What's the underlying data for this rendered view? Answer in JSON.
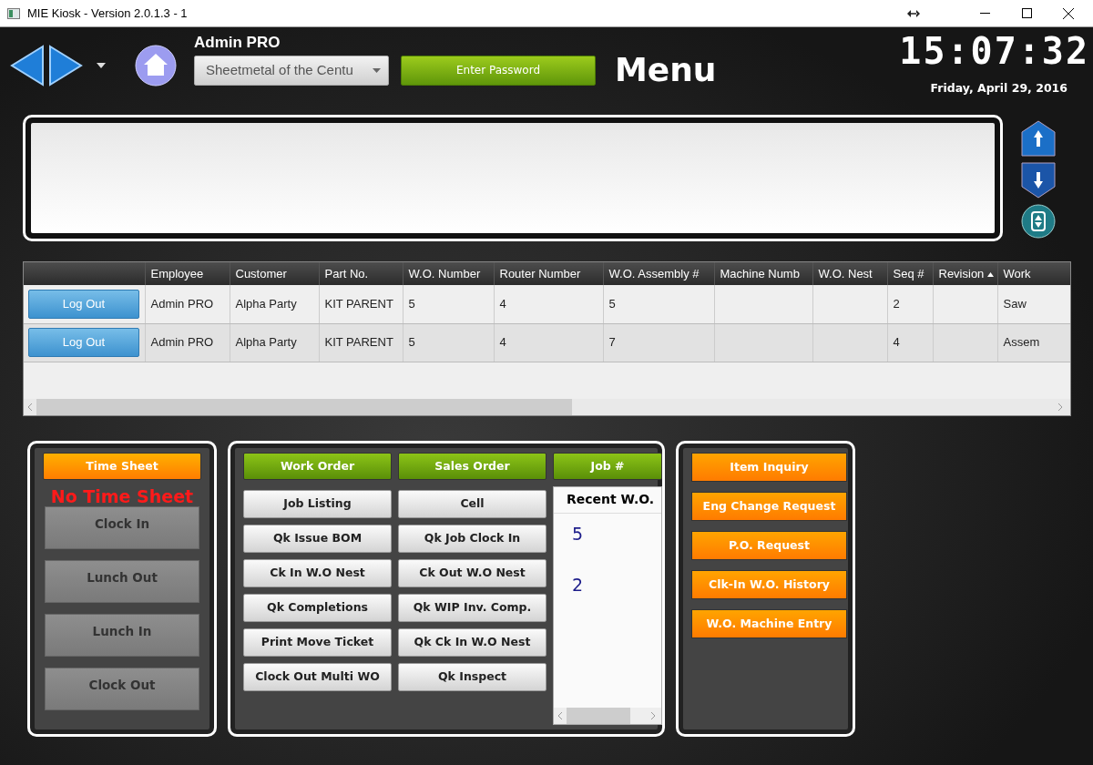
{
  "window": {
    "title": "MIE Kiosk - Version 2.0.1.3 - 1"
  },
  "header": {
    "user": "Admin PRO",
    "company_select": {
      "value": "Sheetmetal of the Centu"
    },
    "password_button": "Enter Password",
    "title": "Menu",
    "clock": "15:07:32",
    "date": "Friday, April 29, 2016"
  },
  "table": {
    "columns": [
      {
        "label": "Employee",
        "sorted": false
      },
      {
        "label": "Customer",
        "sorted": false
      },
      {
        "label": "Part No.",
        "sorted": false
      },
      {
        "label": "W.O. Number",
        "sorted": false
      },
      {
        "label": "Router Number",
        "sorted": false
      },
      {
        "label": "W.O. Assembly #",
        "sorted": false
      },
      {
        "label": "Machine Numb",
        "sorted": false
      },
      {
        "label": "W.O. Nest",
        "sorted": false
      },
      {
        "label": "Seq #",
        "sorted": false
      },
      {
        "label": "Revision",
        "sorted": true
      },
      {
        "label": "Work",
        "sorted": false
      }
    ],
    "rows": [
      {
        "action": "Log Out",
        "cells": [
          "Admin PRO",
          "Alpha Party",
          "KIT PARENT",
          "5",
          "4",
          "5",
          "",
          "",
          "2",
          "",
          "Saw"
        ]
      },
      {
        "action": "Log Out",
        "cells": [
          "Admin PRO",
          "Alpha Party",
          "KIT PARENT",
          "5",
          "4",
          "7",
          "",
          "",
          "4",
          "",
          "Assem"
        ]
      }
    ]
  },
  "time_sheet": {
    "header": "Time Sheet",
    "status": "No Time Sheet",
    "buttons": [
      {
        "label": "Clock In",
        "disabled": true
      },
      {
        "label": "Lunch Out",
        "disabled": true
      },
      {
        "label": "Lunch In",
        "disabled": true
      },
      {
        "label": "Clock Out",
        "disabled": true
      }
    ]
  },
  "orders": {
    "headers": [
      "Work Order",
      "Sales Order",
      "Job #"
    ],
    "buttons": [
      [
        "Job Listing",
        "Qk Issue BOM",
        "Ck In W.O Nest",
        "Qk Completions",
        "Print Move Ticket",
        "Clock Out Multi WO"
      ],
      [
        "Cell",
        "Qk Job Clock In",
        "Ck Out W.O Nest",
        "Qk WIP Inv. Comp.",
        "Qk Ck In W.O Nest",
        "Qk Inspect"
      ]
    ],
    "recent": {
      "title": "Recent W.O.",
      "items": [
        "5",
        "2"
      ]
    }
  },
  "inquiry": {
    "buttons": [
      "Item Inquiry",
      "Eng Change Request",
      "P.O. Request",
      "Clk-In W.O. History",
      "W.O. Machine Entry"
    ]
  }
}
